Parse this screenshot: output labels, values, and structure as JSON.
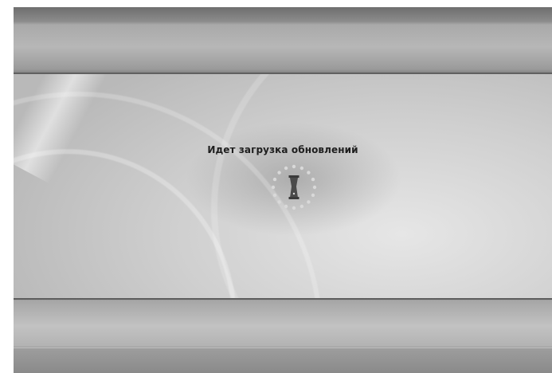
{
  "status": {
    "message": "Идет загрузка обновлений"
  },
  "spinner": {
    "icon": "loading-spinner-icon",
    "dot_color": "#d9d9d9",
    "glyph_color": "#4a4a4a"
  },
  "colors": {
    "background_center": "#e6e6e6",
    "band_dark": "#6e6e6e",
    "band_light": "#b7b7b7",
    "text": "#1e1e1e"
  }
}
